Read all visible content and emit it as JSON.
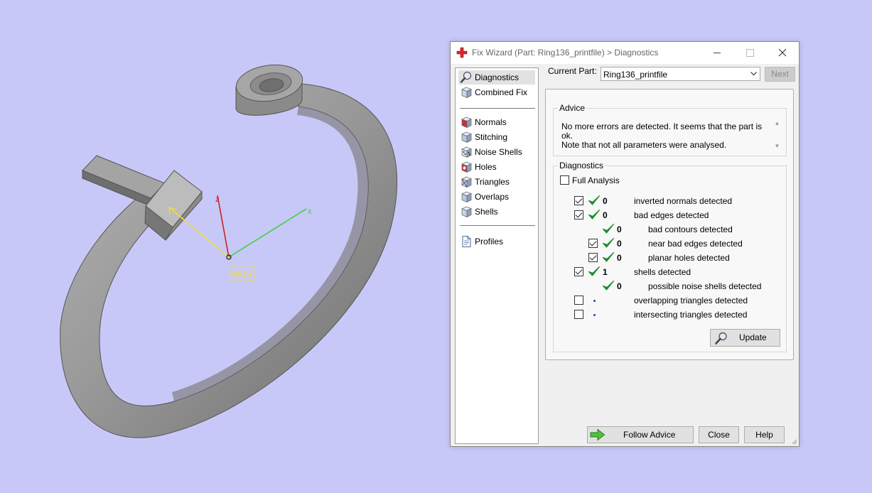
{
  "viewport": {
    "axis_x": "x",
    "axis_z": "z",
    "wcs_label": "WCS"
  },
  "dialog": {
    "title": "Fix Wizard (Part: Ring136_printfile) > Diagnostics",
    "nav": [
      {
        "label": "Diagnostics",
        "icon": "diagnostics-magnifier-icon",
        "selected": true
      },
      {
        "label": "Combined Fix",
        "icon": "combined-fix-cube-icon"
      },
      {
        "label": "Normals",
        "icon": "normals-cube-icon"
      },
      {
        "label": "Stitching",
        "icon": "stitching-cube-icon"
      },
      {
        "label": "Noise Shells",
        "icon": "noise-shells-cube-icon"
      },
      {
        "label": "Holes",
        "icon": "holes-cube-icon"
      },
      {
        "label": "Triangles",
        "icon": "triangles-cube-icon"
      },
      {
        "label": "Overlaps",
        "icon": "overlaps-cube-icon"
      },
      {
        "label": "Shells",
        "icon": "shells-cube-icon"
      },
      {
        "label": "Profiles",
        "icon": "profiles-document-icon"
      }
    ],
    "current_part_label": "Current Part:",
    "current_part_value": "Ring136_printfile",
    "next_label": "Next",
    "advice": {
      "title": "Advice",
      "text": "No more errors are detected. It seems that the part is ok.\nNote that not all parameters were analysed."
    },
    "diagnostics": {
      "title": "Diagnostics",
      "full_analysis_label": "Full Analysis",
      "full_analysis_checked": false,
      "rows": [
        {
          "checkbox": true,
          "checked": true,
          "status": "ok",
          "count": "0",
          "label": "inverted normals detected",
          "indent": 0
        },
        {
          "checkbox": true,
          "checked": true,
          "status": "ok",
          "count": "0",
          "label": "bad edges detected",
          "indent": 0
        },
        {
          "checkbox": false,
          "checked": false,
          "status": "ok",
          "count": "0",
          "label": "bad contours detected",
          "indent": 1
        },
        {
          "checkbox": true,
          "checked": true,
          "status": "ok",
          "count": "0",
          "label": "near bad edges detected",
          "indent": 1
        },
        {
          "checkbox": true,
          "checked": true,
          "status": "ok",
          "count": "0",
          "label": "planar holes detected",
          "indent": 1
        },
        {
          "checkbox": true,
          "checked": true,
          "status": "ok",
          "count": "1",
          "label": "shells detected",
          "indent": 0
        },
        {
          "checkbox": false,
          "checked": false,
          "status": "ok",
          "count": "0",
          "label": "possible noise shells detected",
          "indent": 1
        },
        {
          "checkbox": true,
          "checked": false,
          "status": "none",
          "count": "",
          "label": "overlapping triangles detected",
          "indent": 0
        },
        {
          "checkbox": true,
          "checked": false,
          "status": "none",
          "count": "",
          "label": "intersecting triangles detected",
          "indent": 0
        }
      ],
      "update_label": "Update"
    },
    "follow_advice_label": "Follow Advice",
    "close_label": "Close",
    "help_label": "Help"
  },
  "colors": {
    "background": "#c8c8f8",
    "check_green": "#1e8c2e",
    "axis_x": "#3cd23c",
    "axis_z": "#d21e1e",
    "axis_wcs": "#f0dc3c"
  }
}
